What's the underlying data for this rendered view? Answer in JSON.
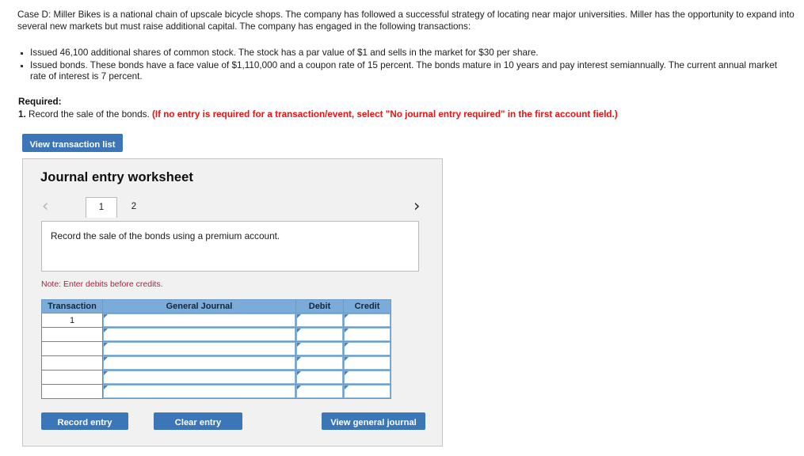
{
  "case": {
    "paragraph": "Case D: Miller Bikes is a national chain of upscale bicycle shops. The company has followed a successful strategy of locating near major universities. Miller has the opportunity to expand into several new markets but must raise additional capital. The company has engaged in the following transactions:",
    "transactions": [
      "Issued 46,100 additional shares of common stock. The stock has a par value of $1 and sells in the market for $30 per share.",
      "Issued bonds. These bonds have a face value of $1,110,000 and a coupon rate of 15 percent. The bonds mature in 10 years and pay interest semiannually. The current annual market rate of interest is 7 percent."
    ]
  },
  "required": {
    "label": "Required:",
    "item_number": "1.",
    "item_text": "Record the sale of the bonds.",
    "note": "(If no entry is required for a transaction/event, select \"No journal entry required\" in the first account field.)"
  },
  "toolbar": {
    "view_transaction_list_label": "View transaction list"
  },
  "worksheet": {
    "title": "Journal entry worksheet",
    "prev_icon": "chevron-left-icon",
    "next_icon": "chevron-right-icon",
    "tabs": [
      {
        "label": "1",
        "active": true
      },
      {
        "label": "2",
        "active": false
      }
    ],
    "prompt": "Record the sale of the bonds using a premium account.",
    "note": "Note: Enter debits before credits.",
    "table": {
      "headers": [
        "Transaction",
        "General Journal",
        "Debit",
        "Credit"
      ],
      "rows": [
        {
          "transaction": "1",
          "general_journal": "",
          "debit": "",
          "credit": ""
        },
        {
          "transaction": "",
          "general_journal": "",
          "debit": "",
          "credit": ""
        },
        {
          "transaction": "",
          "general_journal": "",
          "debit": "",
          "credit": ""
        },
        {
          "transaction": "",
          "general_journal": "",
          "debit": "",
          "credit": ""
        },
        {
          "transaction": "",
          "general_journal": "",
          "debit": "",
          "credit": ""
        },
        {
          "transaction": "",
          "general_journal": "",
          "debit": "",
          "credit": ""
        }
      ]
    },
    "buttons": {
      "record_entry": "Record entry",
      "clear_entry": "Clear entry",
      "view_general_journal": "View general journal"
    }
  },
  "colors": {
    "button_blue": "#3a76b8",
    "table_header_blue": "#7bacd9",
    "note_red": "#9c2743",
    "instruction_red": "#ee1111",
    "panel_bg": "#f1f1f1"
  }
}
